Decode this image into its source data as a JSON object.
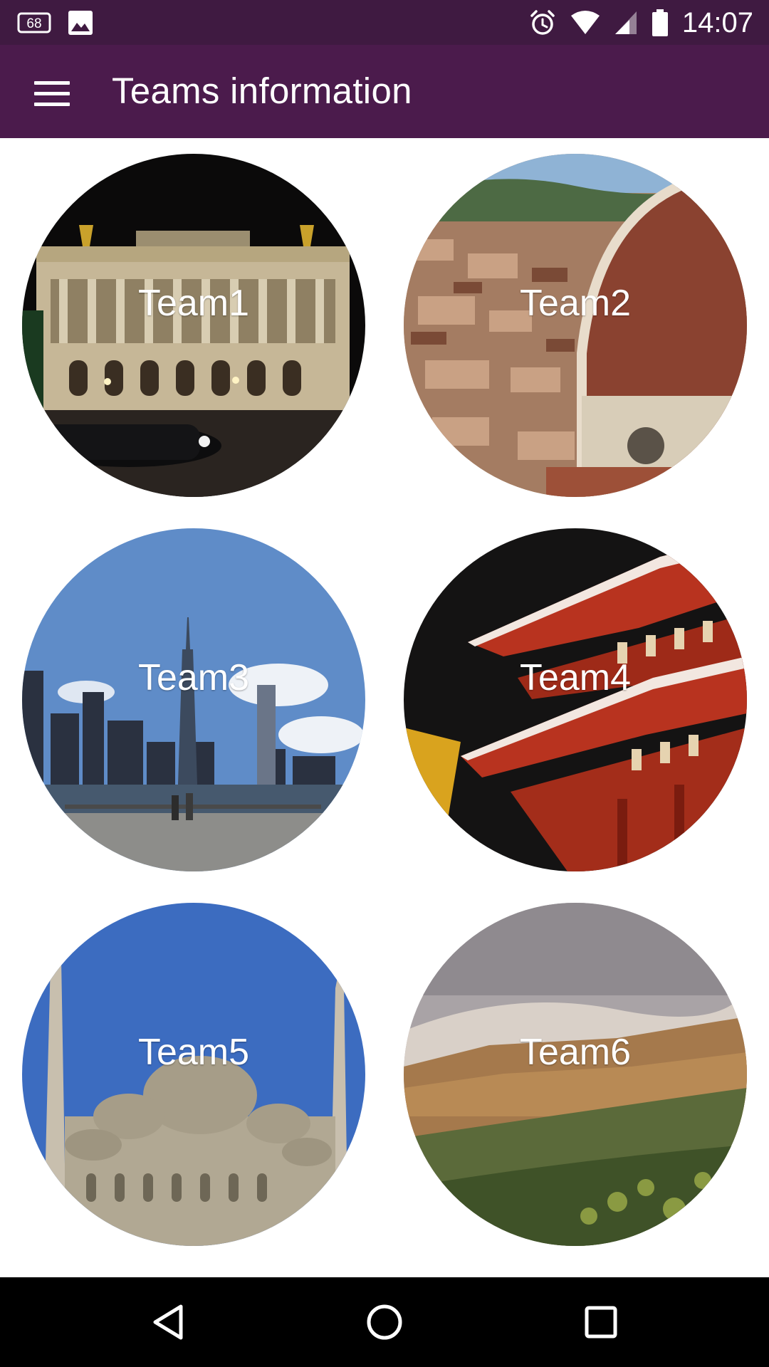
{
  "status_bar": {
    "notification_icons": [
      "68-badge-icon",
      "image-icon"
    ],
    "system_icons": [
      "alarm-icon",
      "wifi-icon",
      "signal-icon",
      "battery-icon"
    ],
    "time": "14:07",
    "notification_badge": "68"
  },
  "app_bar": {
    "menu_icon": "hamburger-menu-icon",
    "title": "Teams information"
  },
  "teams": [
    {
      "label": "Team1",
      "photo": "opera-house-at-night"
    },
    {
      "label": "Team2",
      "photo": "florence-cathedral-dome"
    },
    {
      "label": "Team3",
      "photo": "new-york-skyline"
    },
    {
      "label": "Team4",
      "photo": "red-pagoda-at-night"
    },
    {
      "label": "Team5",
      "photo": "blue-mosque"
    },
    {
      "label": "Team6",
      "photo": "table-mountain-clouds"
    }
  ],
  "nav_bar": {
    "buttons": [
      "back-icon",
      "home-icon",
      "recents-icon"
    ]
  },
  "colors": {
    "status_bar": "#3f1a41",
    "app_bar": "#4b1b4c",
    "nav_bar": "#000000",
    "text_on_dark": "#ffffff"
  }
}
